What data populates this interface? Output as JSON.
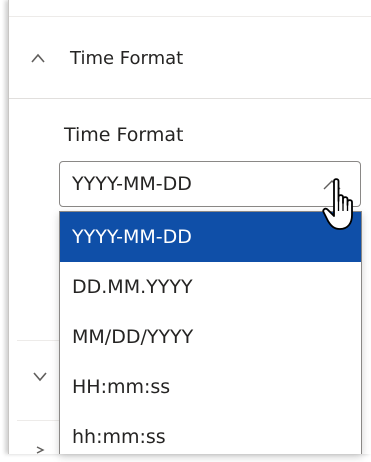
{
  "section": {
    "title": "Time Format",
    "expanded": true,
    "chevron_icon": "chevron-up-icon"
  },
  "field": {
    "label": "Time Format",
    "selected_value": "YYYY-MM-DD",
    "dropdown_icon": "chevron-up-icon"
  },
  "dropdown": {
    "options": [
      {
        "label": "YYYY-MM-DD",
        "selected": true
      },
      {
        "label": "DD.MM.YYYY",
        "selected": false
      },
      {
        "label": "MM/DD/YYYY",
        "selected": false
      },
      {
        "label": "HH:mm:ss",
        "selected": false
      },
      {
        "label": "hh:mm:ss",
        "selected": false
      }
    ]
  },
  "collapsed_sections_icon": "chevron-down-icon",
  "cursor_icon": "hand-pointer-icon",
  "colors": {
    "selected_bg": "#0f4fa8",
    "selected_text": "#ffffff",
    "text": "#252423",
    "border": "#8a8886"
  }
}
